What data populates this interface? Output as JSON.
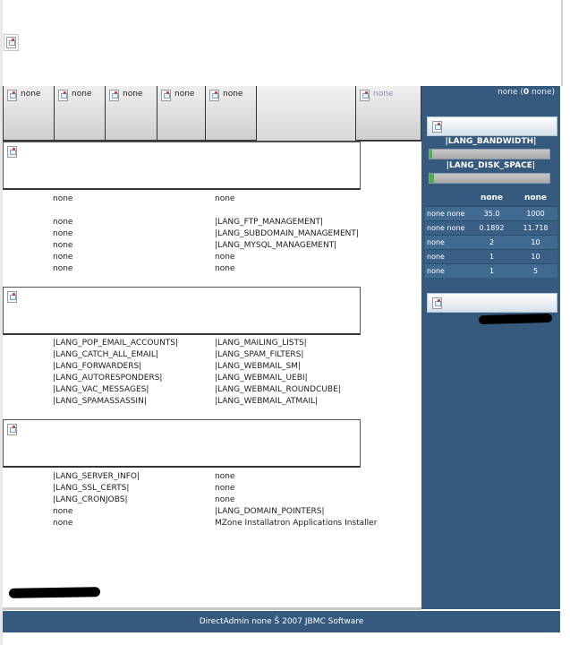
{
  "header": {
    "logo_icon": "broken-image-icon"
  },
  "tabs": [
    {
      "label": "none"
    },
    {
      "label": "none"
    },
    {
      "label": "none"
    },
    {
      "label": "none"
    },
    {
      "label": "none"
    },
    {
      "label": "none"
    }
  ],
  "sidebar": {
    "user_name": "none",
    "count": "0",
    "user_suffix": "none",
    "bandwidth_label": "|LANG_BANDWIDTH|",
    "disk_label": "|LANG_DISK_SPACE|",
    "bandwidth_usage_fraction": 0.02,
    "disk_usage_fraction": 0.04,
    "stats_header": {
      "col1": "none",
      "col2": "none"
    },
    "stats": [
      {
        "label": "none none",
        "used": "35.0",
        "max": "1000"
      },
      {
        "label": "none none",
        "used": "0.1892",
        "max": "11.718"
      },
      {
        "label": "none",
        "used": "2",
        "max": "10"
      },
      {
        "label": "none",
        "used": "1",
        "max": "10"
      },
      {
        "label": "none",
        "used": "1",
        "max": "5"
      }
    ]
  },
  "sections": [
    {
      "rows": [
        {
          "c1": "none",
          "c2": "none"
        },
        {
          "c1": "",
          "c2": ""
        },
        {
          "c1": "none",
          "c2": "|LANG_FTP_MANAGEMENT|"
        },
        {
          "c1": "none",
          "c2": "|LANG_SUBDOMAIN_MANAGEMENT|"
        },
        {
          "c1": "none",
          "c2": "|LANG_MYSQL_MANAGEMENT|"
        },
        {
          "c1": "none",
          "c2": "none"
        },
        {
          "c1": "none",
          "c2": "none"
        }
      ]
    },
    {
      "rows": [
        {
          "c1": "|LANG_POP_EMAIL_ACCOUNTS|",
          "c2": "|LANG_MAILING_LISTS|"
        },
        {
          "c1": "|LANG_CATCH_ALL_EMAIL|",
          "c2": "|LANG_SPAM_FILTERS|"
        },
        {
          "c1": "|LANG_FORWARDERS|",
          "c2": "|LANG_WEBMAIL_SM|"
        },
        {
          "c1": "|LANG_AUTORESPONDERS|",
          "c2": "|LANG_WEBMAIL_UEBI|"
        },
        {
          "c1": "|LANG_VAC_MESSAGES|",
          "c2": "|LANG_WEBMAIL_ROUNDCUBE|"
        },
        {
          "c1": "|LANG_SPAMASSASSIN|",
          "c2": "|LANG_WEBMAIL_ATMAIL|"
        }
      ]
    },
    {
      "rows": [
        {
          "c1": "|LANG_SERVER_INFO|",
          "c2": "none"
        },
        {
          "c1": "|LANG_SSL_CERTS|",
          "c2": "none"
        },
        {
          "c1": "|LANG_CRONJOBS|",
          "c2": "none"
        },
        {
          "c1": "none",
          "c2": "|LANG_DOMAIN_POINTERS|"
        },
        {
          "c1": "none",
          "c2": "MZone Installatron Applications Installer"
        }
      ]
    }
  ],
  "footer": {
    "text": "DirectAdmin none Š 2007 JBMC Software"
  },
  "colors": {
    "sidebar_bg": "#355a7e",
    "gauge_fill": "#4caf4c"
  }
}
